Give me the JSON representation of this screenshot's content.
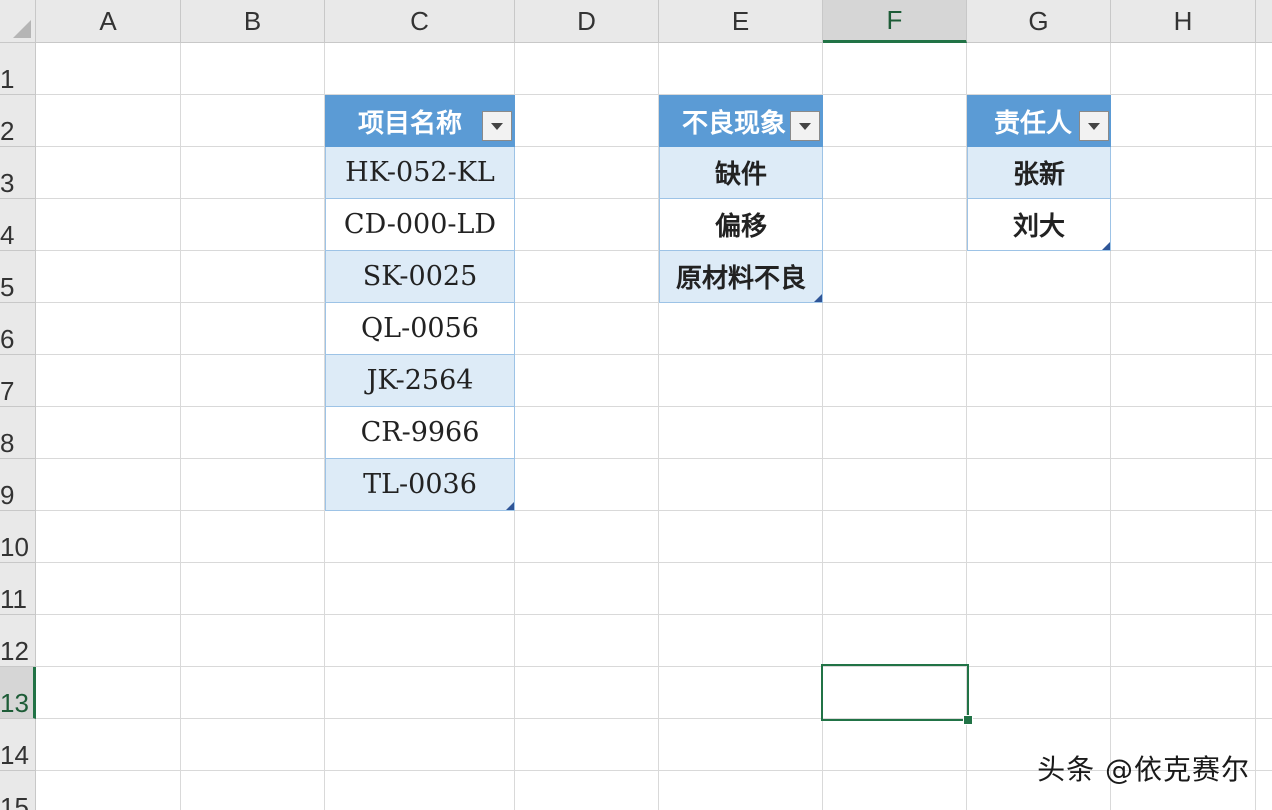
{
  "columns": [
    "A",
    "B",
    "C",
    "D",
    "E",
    "F",
    "G",
    "H"
  ],
  "rows": [
    "1",
    "2",
    "3",
    "4",
    "5",
    "6",
    "7",
    "8",
    "9",
    "10",
    "11",
    "12",
    "13",
    "14",
    "15"
  ],
  "active_column": "F",
  "active_row": "13",
  "tables": {
    "project": {
      "header": "项目名称",
      "items": [
        "HK-052-KL",
        "CD-000-LD",
        "SK-0025",
        "QL-0056",
        "JK-2564",
        "CR-9966",
        "TL-0036"
      ]
    },
    "defect": {
      "header": "不良现象",
      "items": [
        "缺件",
        "偏移",
        "原材料不良"
      ]
    },
    "owner": {
      "header": "责任人",
      "items": [
        "张新",
        "刘大"
      ]
    }
  },
  "watermark": "头条 @依克赛尔",
  "colors": {
    "table_header": "#5b9bd5",
    "table_band": "#ddebf7",
    "selection": "#217346"
  }
}
